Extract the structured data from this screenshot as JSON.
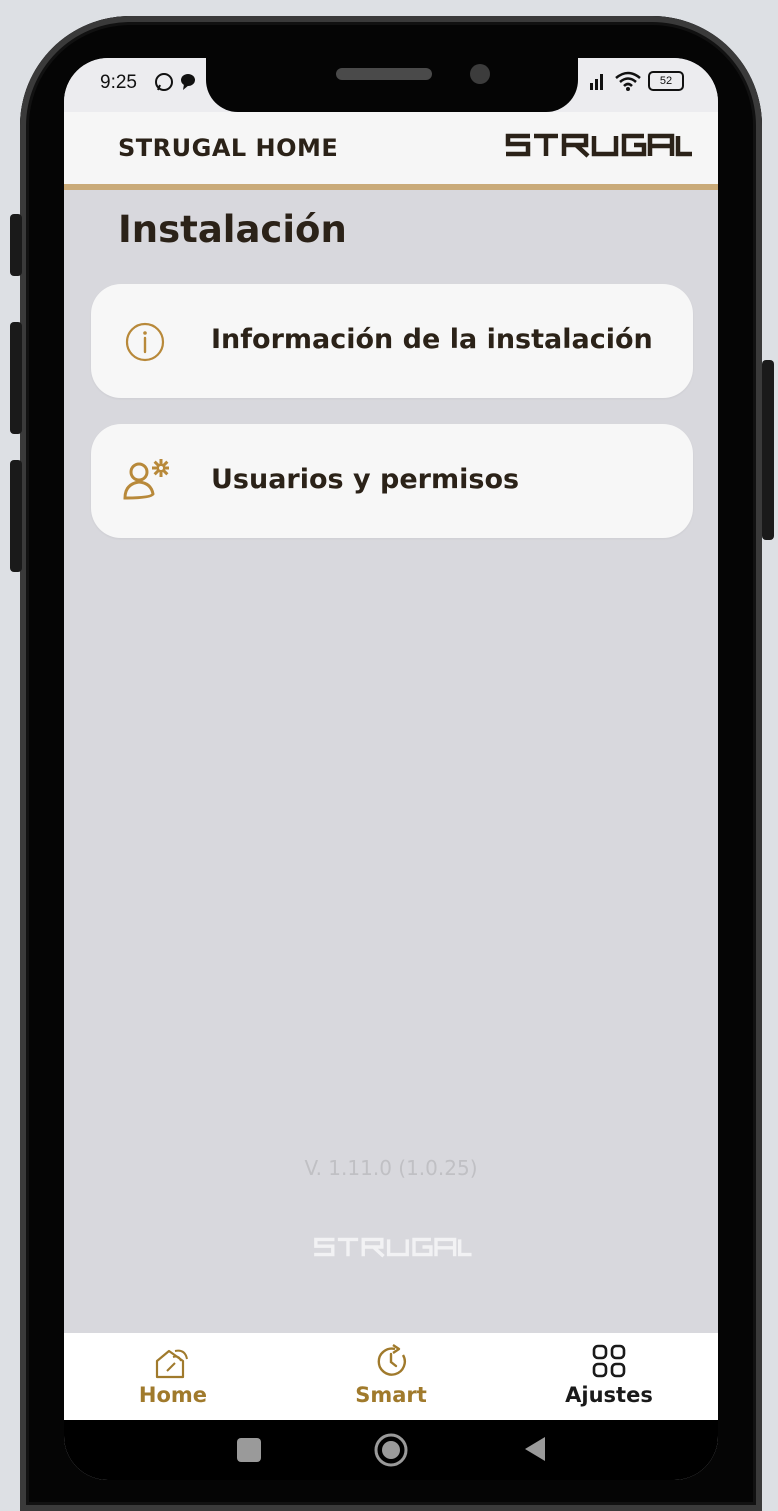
{
  "status_bar": {
    "time": "9:25",
    "battery": "52"
  },
  "app_bar": {
    "title": "STRUGAL HOME",
    "brand": "STRUGAL"
  },
  "page": {
    "title": "Instalación"
  },
  "menu": {
    "items": [
      {
        "label": "Información de la instalación",
        "icon": "info-icon"
      },
      {
        "label": "Usuarios y permisos",
        "icon": "user-settings-icon"
      }
    ]
  },
  "footer": {
    "version": "V. 1.11.0 (1.0.25)",
    "brand": "STRUGAL"
  },
  "tabs": [
    {
      "label": "Home",
      "icon": "home-signal-icon",
      "color": "#a07a2c"
    },
    {
      "label": "Smart",
      "icon": "clock-refresh-icon",
      "color": "#a07a2c"
    },
    {
      "label": "Ajustes",
      "icon": "grid-icon",
      "color": "#1a1a1a"
    }
  ],
  "colors": {
    "accent": "#c9aa79",
    "icon_gold": "#b8893a",
    "text_dark": "#2b2218",
    "background": "#d8d8dd"
  }
}
